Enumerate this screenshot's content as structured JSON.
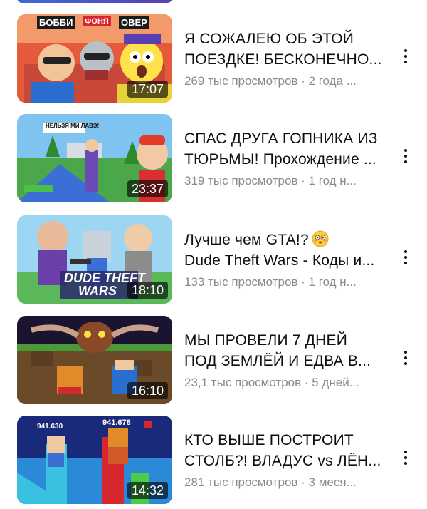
{
  "videos": [
    {
      "title_line1": "Я СОЖАЛЕЮ ОБ ЭТОЙ",
      "title_line2": "ПОЕЗДКЕ! БЕСКОНЕЧНО...",
      "meta": "269 тыс просмотров · 2 года ...",
      "duration": "17:07",
      "thumb_labels": [
        "БОББИ",
        "ФОНЯ",
        "ОВЕР"
      ]
    },
    {
      "title_line1": "СПАС ДРУГА ГОПНИКА ИЗ",
      "title_line2": "ТЮРЬМЫ! Прохождение ...",
      "meta": "319 тыс просмотров · 1 год н...",
      "duration": "23:37",
      "thumb_labels": [
        "НЕЛЬЗЯ МИ ЛАВЭ!"
      ]
    },
    {
      "title_line1": "Лучше чем GTA!?",
      "title_line2": "Dude Theft Wars - Коды и...",
      "meta": "133 тыс просмотров · 1 год н...",
      "duration": "18:10",
      "thumb_labels": [
        "DUDE THEFT",
        "WARS"
      ]
    },
    {
      "title_line1": "МЫ ПРОВЕЛИ 7 ДНЕЙ",
      "title_line2": "ПОД ЗЕМЛЁЙ И ЕДВА В...",
      "meta": "23,1 тыс просмотров · 5 дней...",
      "duration": "16:10",
      "thumb_labels": []
    },
    {
      "title_line1": "КТО ВЫШЕ ПОСТРОИТ",
      "title_line2": "СТОЛБ?! ВЛАДУС vs ЛЁН...",
      "meta": "281 тыс просмотров · 3 меся...",
      "duration": "14:32",
      "thumb_labels": [
        "941.630",
        "941.678"
      ]
    }
  ],
  "icons": {
    "more": "more-vert-icon",
    "emoji": "flushed-face-emoji-icon"
  },
  "colors": {
    "title": "#0f0f0f",
    "meta": "#8a8a8a",
    "duration_bg": "#000000"
  }
}
